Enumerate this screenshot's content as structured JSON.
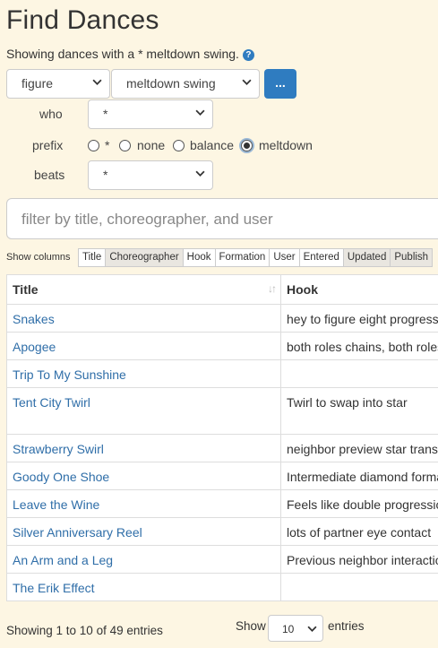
{
  "page": {
    "title": "Find Dances",
    "showing_text": "Showing dances with a * meltdown swing.",
    "help_icon": "?"
  },
  "query": {
    "type_select": "figure",
    "figure_select": "meltdown swing",
    "more_button": "...",
    "who_label": "who",
    "who_value": "*",
    "prefix_label": "prefix",
    "prefix_options": [
      "*",
      "none",
      "balance",
      "meltdown"
    ],
    "prefix_selected": "meltdown",
    "beats_label": "beats",
    "beats_value": "*"
  },
  "filter": {
    "placeholder": "filter by title, choreographer, and user"
  },
  "columns": {
    "label": "Show columns",
    "buttons": [
      {
        "label": "Title",
        "on": true
      },
      {
        "label": "Choreographer",
        "on": false
      },
      {
        "label": "Hook",
        "on": true
      },
      {
        "label": "Formation",
        "on": true
      },
      {
        "label": "User",
        "on": true
      },
      {
        "label": "Entered",
        "on": true
      },
      {
        "label": "Updated",
        "on": false
      },
      {
        "label": "Publish",
        "on": false
      }
    ]
  },
  "table": {
    "headers": [
      "Title",
      "Hook"
    ],
    "rows": [
      {
        "title": "Snakes",
        "hook": "hey to figure eight progression"
      },
      {
        "title": "Apogee",
        "hook": "both roles chains, both roles"
      },
      {
        "title": "Trip To My Sunshine",
        "hook": ""
      },
      {
        "title": "Tent City Twirl",
        "hook": "Twirl to swap into star"
      },
      {
        "title": "Strawberry Swirl",
        "hook": "neighbor preview star transition"
      },
      {
        "title": "Goody One Shoe",
        "hook": "Intermediate diamond formation"
      },
      {
        "title": "Leave the Wine",
        "hook": "Feels like double progression"
      },
      {
        "title": "Silver Anniversary Reel",
        "hook": "lots of partner eye contact"
      },
      {
        "title": "An Arm and a Leg",
        "hook": "Previous neighbor interaction"
      },
      {
        "title": "The Erik Effect",
        "hook": ""
      }
    ]
  },
  "footer": {
    "info": "Showing 1 to 10 of 49 entries",
    "show_label": "Show",
    "length_value": "10",
    "entries_label": "entries"
  },
  "colors": {
    "accent": "#2f7cc0",
    "link": "#2f6ea8",
    "background": "#fdf6e3"
  }
}
